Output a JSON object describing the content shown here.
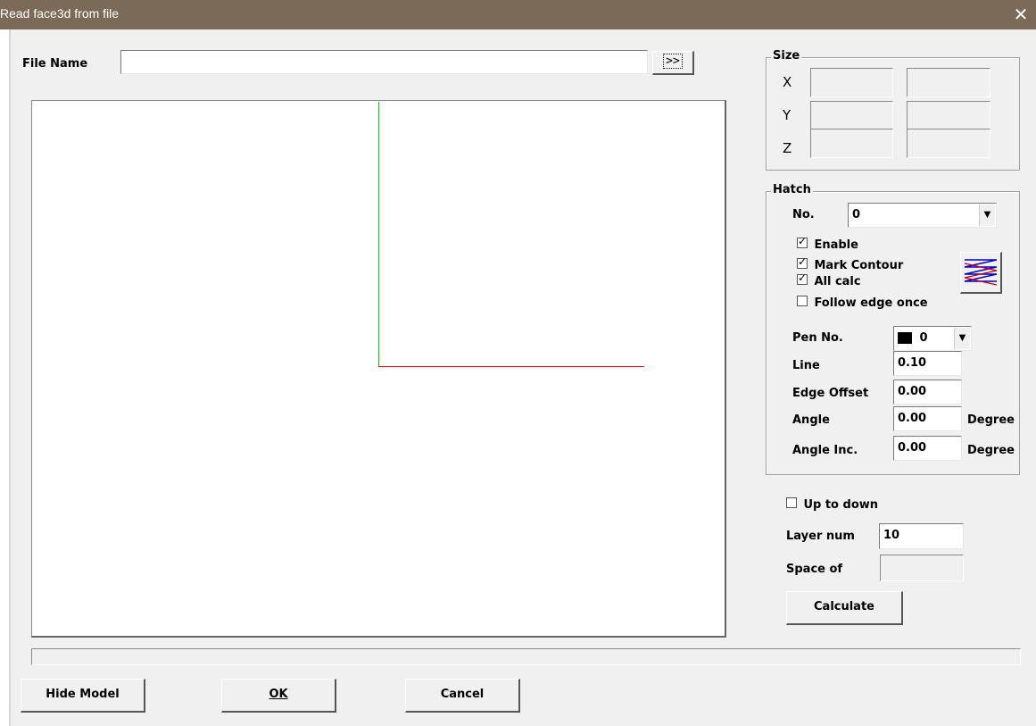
{
  "window": {
    "title": "Read face3d from file",
    "close_glyph": "✕"
  },
  "file": {
    "label": "File Name",
    "value": "",
    "browse_label": ">>"
  },
  "size": {
    "label": "Size",
    "rows": [
      {
        "axis": "X",
        "min": "",
        "max": ""
      },
      {
        "axis": "Y",
        "min": "",
        "max": ""
      },
      {
        "axis": "Z",
        "min": "",
        "max": ""
      }
    ]
  },
  "hatch": {
    "label": "Hatch",
    "no_label": "No.",
    "no_value": "0",
    "enable_label": "Enable",
    "enable_checked": true,
    "mark_contour_label": "Mark Contour",
    "mark_contour_checked": true,
    "all_calc_label": "All calc",
    "all_calc_checked": true,
    "follow_edge_label": "Follow edge once",
    "follow_edge_checked": false,
    "pen_label": "Pen No.",
    "pen_value": "0",
    "pen_color": "#000000",
    "line_label": "Line",
    "line_value": "0.10",
    "edge_offset_label": "Edge Offset",
    "edge_offset_value": "0.00",
    "angle_label": "Angle",
    "angle_value": "0.00",
    "angle_unit": "Degree",
    "angle_inc_label": "Angle Inc.",
    "angle_inc_value": "0.00",
    "angle_inc_unit": "Degree"
  },
  "layers": {
    "up_to_down_label": "Up to down",
    "up_to_down_checked": false,
    "layer_num_label": "Layer num",
    "layer_num_value": "10",
    "space_of_label": "Space of",
    "space_of_value": "",
    "calculate_label": "Calculate"
  },
  "preview": {
    "axis_y_color": "#00cc00",
    "axis_x_color": "#ff0000"
  },
  "footer": {
    "hide_model_label": "Hide Model",
    "ok_label": "OK",
    "cancel_label": "Cancel"
  }
}
